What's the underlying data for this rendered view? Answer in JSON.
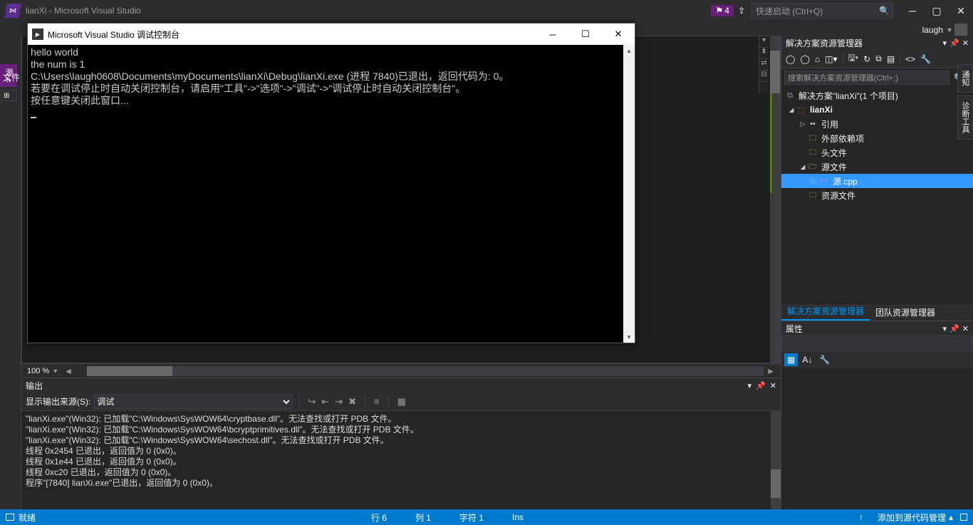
{
  "titlebar": {
    "title": "lianXi - Microsoft Visual Studio",
    "notification_count": "4",
    "quicklaunch_placeholder": "快速启动 (Ctrl+Q)"
  },
  "user": {
    "name": "laugh"
  },
  "menu": {
    "file": "文件"
  },
  "editor": {
    "zoom": "100 %"
  },
  "output": {
    "title": "输出",
    "source_label": "显示输出来源(S):",
    "source_value": "调试",
    "lines": [
      "\"lianXi.exe\"(Win32): 已加载\"C:\\Windows\\SysWOW64\\cryptbase.dll\"。无法查找或打开 PDB 文件。",
      "\"lianXi.exe\"(Win32): 已加载\"C:\\Windows\\SysWOW64\\bcryptprimitives.dll\"。无法查找或打开 PDB 文件。",
      "\"lianXi.exe\"(Win32): 已加载\"C:\\Windows\\SysWOW64\\sechost.dll\"。无法查找或打开 PDB 文件。",
      "线程 0x2454 已退出，返回值为 0 (0x0)。",
      "线程 0x1e44 已退出，返回值为 0 (0x0)。",
      "线程 0xc20 已退出，返回值为 0 (0x0)。",
      "程序\"[7840] lianXi.exe\"已退出，返回值为 0 (0x0)。"
    ]
  },
  "solution_explorer": {
    "title": "解决方案资源管理器",
    "search_placeholder": "搜索解决方案资源管理器(Ctrl+;)",
    "solution_label": "解决方案\"lianXi\"(1 个项目)",
    "project": "lianXi",
    "refs": "引用",
    "external": "外部依赖项",
    "headers": "头文件",
    "sources": "源文件",
    "source_file": "源.cpp",
    "resources": "资源文件",
    "tab_active": "解决方案资源管理器",
    "tab_inactive": "团队资源管理器"
  },
  "properties": {
    "title": "属性"
  },
  "right_rail": {
    "notifs": "通知",
    "toolbar": "诊断工具"
  },
  "left_rail": {
    "source_tab": "源.c"
  },
  "status": {
    "ready": "就绪",
    "line": "行 6",
    "col": "列 1",
    "char": "字符 1",
    "ins": "Ins",
    "scm": "添加到源代码管理"
  },
  "console": {
    "title": "Microsoft Visual Studio 调试控制台",
    "lines": [
      "hello world",
      "the num is 1",
      "C:\\Users\\laugh0608\\Documents\\myDocuments\\lianXi\\Debug\\lianXi.exe (进程 7840)已退出，返回代码为: 0。",
      "若要在调试停止时自动关闭控制台，请启用\"工具\"->\"选项\"->\"调试\"->\"调试停止时自动关闭控制台\"。",
      "按任意键关闭此窗口..."
    ]
  }
}
